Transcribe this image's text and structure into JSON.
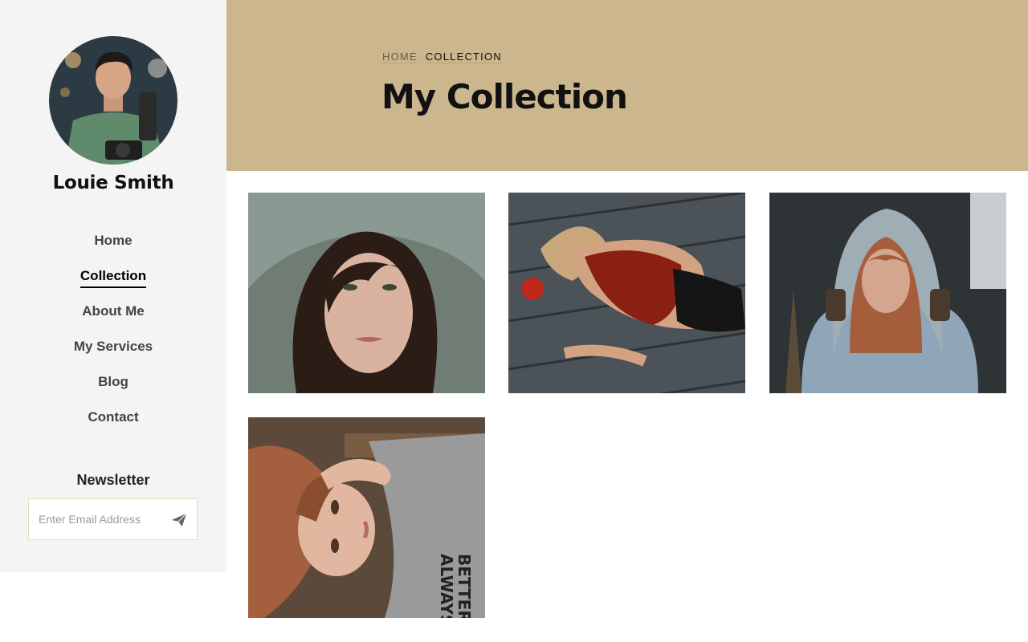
{
  "profile": {
    "name": "Louie Smith",
    "avatar_icon": "avatar-photographer-icon"
  },
  "nav": {
    "items": [
      {
        "label": "Home",
        "active": false
      },
      {
        "label": "Collection",
        "active": true
      },
      {
        "label": "About Me",
        "active": false
      },
      {
        "label": "My Services",
        "active": false
      },
      {
        "label": "Blog",
        "active": false
      },
      {
        "label": "Contact",
        "active": false
      }
    ]
  },
  "newsletter": {
    "title": "Newsletter",
    "placeholder": "Enter Email Address",
    "send_icon": "paper-plane-icon"
  },
  "header": {
    "breadcrumb": {
      "home": "HOME",
      "current": "COLLECTION"
    },
    "title": "My Collection"
  },
  "colors": {
    "header_bg": "#ccb68d",
    "sidebar_bg": "#f4f4f4"
  }
}
